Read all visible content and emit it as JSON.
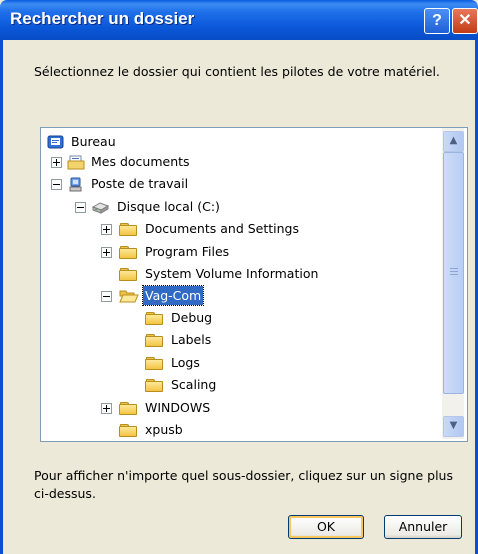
{
  "window": {
    "title": "Rechercher un dossier",
    "help_glyph": "?",
    "close_glyph": "✕"
  },
  "instruction": "Sélectionnez le dossier qui contient les pilotes de votre matériel.",
  "tree": {
    "items": [
      {
        "label": "Bureau",
        "icon": "desktop-icon",
        "expander": "none"
      },
      {
        "label": "Mes documents",
        "icon": "my-documents-icon",
        "expander": "plus"
      },
      {
        "label": "Poste de travail",
        "icon": "my-computer-icon",
        "expander": "minus"
      },
      {
        "label": "Disque local (C:)",
        "icon": "hard-drive-icon",
        "expander": "minus"
      },
      {
        "label": "Documents and Settings",
        "icon": "folder-icon",
        "expander": "plus"
      },
      {
        "label": "Program Files",
        "icon": "folder-icon",
        "expander": "plus"
      },
      {
        "label": "System Volume Information",
        "icon": "folder-icon",
        "expander": "none"
      },
      {
        "label": "Vag-Com",
        "icon": "folder-open-icon",
        "expander": "minus",
        "selected": true
      },
      {
        "label": "Debug",
        "icon": "folder-icon",
        "expander": "none"
      },
      {
        "label": "Labels",
        "icon": "folder-icon",
        "expander": "none"
      },
      {
        "label": "Logs",
        "icon": "folder-icon",
        "expander": "none"
      },
      {
        "label": "Scaling",
        "icon": "folder-icon",
        "expander": "none"
      },
      {
        "label": "WINDOWS",
        "icon": "folder-icon",
        "expander": "plus"
      },
      {
        "label": "xpusb",
        "icon": "folder-icon",
        "expander": "none"
      }
    ]
  },
  "scrollbar": {
    "up_glyph": "▲",
    "down_glyph": "▼"
  },
  "footer_text": "Pour afficher n'importe quel sous-dossier, cliquez sur un signe plus ci-dessus.",
  "buttons": {
    "ok": "OK",
    "cancel": "Annuler"
  }
}
